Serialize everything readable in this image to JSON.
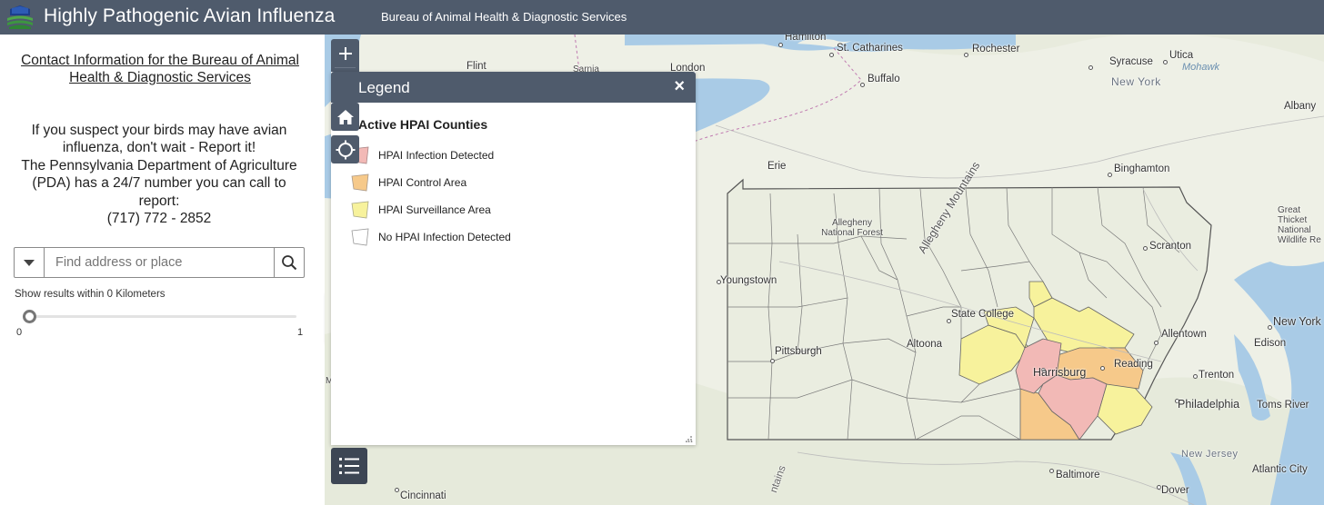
{
  "header": {
    "title": "Highly Pathogenic Avian Influenza",
    "subtitle": "Bureau of Animal Health & Diagnostic Services"
  },
  "sidebar": {
    "contact_link": "Contact Information for the Bureau of Animal Health & Diagnostic Services",
    "report_line1": "If you suspect your birds may have avian influenza, don't wait - Report it!",
    "report_line2": "The Pennsylvania Department of Agriculture (PDA) has a 24/7 number you can call to report:",
    "phone": "(717) 772 - 2852",
    "search": {
      "placeholder": "Find address or place"
    },
    "results_label": "Show results within 0 Kilometers",
    "slider": {
      "min": "0",
      "max": "1",
      "value": 0
    }
  },
  "legend": {
    "title": "Legend",
    "close": "×",
    "layer_title": "Active HPAI Counties",
    "items": [
      {
        "label": "HPAI Infection Detected",
        "color": "#f2b9b6"
      },
      {
        "label": "HPAI Control Area",
        "color": "#f6c98a"
      },
      {
        "label": "HPAI Surveillance Area",
        "color": "#f7f29c"
      },
      {
        "label": "No HPAI Infection Detected",
        "color": "#ffffff"
      }
    ]
  },
  "map": {
    "labels": {
      "hamilton": "Hamilton",
      "st_catharines": "St. Catharines",
      "rochester": "Rochester",
      "syracuse": "Syracuse",
      "utica": "Utica",
      "mohawk": "Mohawk",
      "new_york_state": "New York",
      "albany": "Albany",
      "flint": "Flint",
      "sarnia": "Sarnia",
      "london": "London",
      "buffalo": "Buffalo",
      "erie": "Erie",
      "binghamton": "Binghamton",
      "allegheny_nf": "Allegheny National Forest",
      "allegheny_mountains": "Allegheny Mountains",
      "great_thicket": "Great Thicket National Wildlife Re",
      "scranton": "Scranton",
      "youngstown": "Youngstown",
      "state_college": "State College",
      "pittsburgh": "Pittsburgh",
      "altoona": "Altoona",
      "allentown": "Allentown",
      "new_york_city": "New York",
      "edison": "Edison",
      "harrisburg": "Harrisburg",
      "reading": "Reading",
      "trenton": "Trenton",
      "philadelphia": "Philadelphia",
      "toms_river": "Toms River",
      "new_jersey": "New Jersey",
      "atlantic_city": "Atlantic City",
      "baltimore": "Baltimore",
      "dover": "Dover",
      "cincinnati": "Cincinnati",
      "mountains": "ntains",
      "m": "M"
    }
  },
  "colors": {
    "header_bg": "#4f5b6c",
    "infection": "#f2b9b6",
    "control": "#f6c98a",
    "surveillance": "#f7f29c",
    "water": "#a9cbe6",
    "land": "#eef0e6"
  }
}
